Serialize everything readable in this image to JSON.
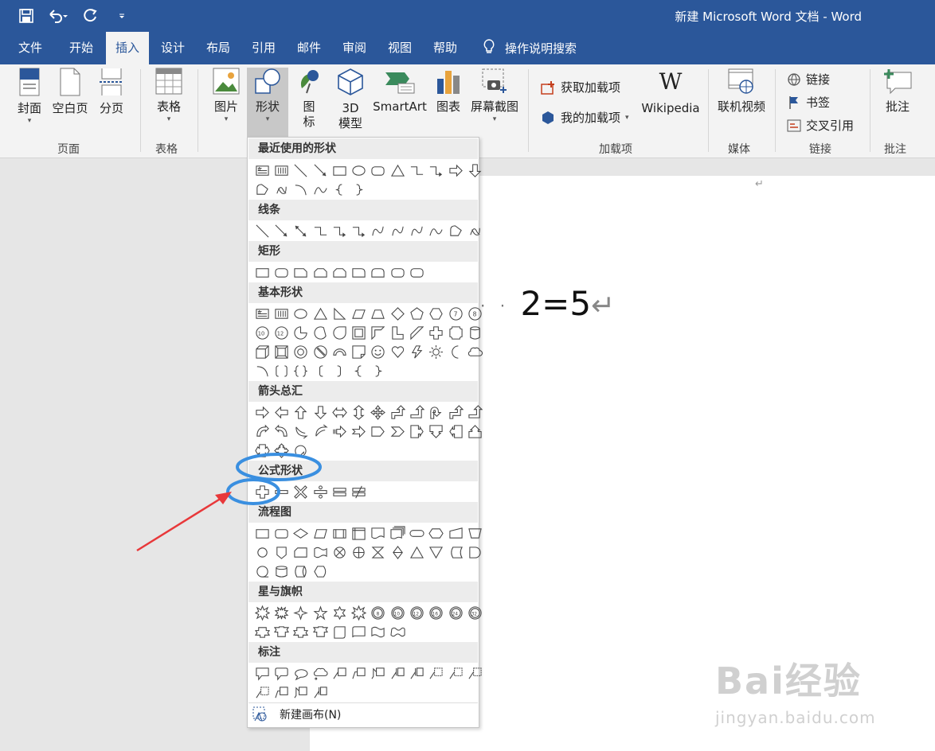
{
  "app": {
    "doc_title": "新建 Microsoft Word 文档 - Word"
  },
  "menu_tabs": [
    "文件",
    "开始",
    "插入",
    "设计",
    "布局",
    "引用",
    "邮件",
    "审阅",
    "视图",
    "帮助"
  ],
  "active_tab": "插入",
  "tell_me": "操作说明搜索",
  "ribbon": {
    "buttons": {
      "cover": "封面",
      "blank": "空白页",
      "break": "分页",
      "table": "表格",
      "picture": "图片",
      "shapes": "形状",
      "icons_line1": "图",
      "icons_line2": "标",
      "model_line1": "3D",
      "model_line2": "模型",
      "smartart": "SmartArt",
      "chart": "图表",
      "screenshot": "屏幕截图",
      "get_addins": "获取加载项",
      "my_addins": "我的加载项",
      "wikipedia": "Wikipedia",
      "online_video": "联机视频",
      "link": "链接",
      "bookmark": "书签",
      "crossref": "交叉引用",
      "comment": "批注"
    },
    "groups": {
      "pages": "页面",
      "tables": "表格",
      "addins": "加载项",
      "media": "媒体",
      "links": "链接",
      "comments": "批注"
    }
  },
  "document": {
    "equation": "2=5"
  },
  "shapes_menu": {
    "sections": {
      "recent": "最近使用的形状",
      "lines": "线条",
      "rectangles": "矩形",
      "basic": "基本形状",
      "arrows": "箭头总汇",
      "equation": "公式形状",
      "flowchart": "流程图",
      "stars": "星与旗帜",
      "callouts": "标注"
    },
    "new_canvas": "新建画布(N)"
  },
  "watermark": {
    "brand": "Bai经验",
    "url": "jingyan.baidu.com"
  }
}
